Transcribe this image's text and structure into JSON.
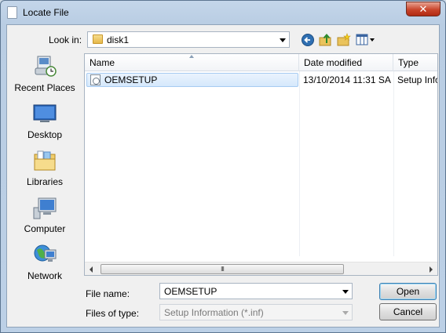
{
  "window": {
    "title": "Locate File",
    "close_glyph": "✕"
  },
  "toolbar": {
    "look_in_label": "Look in:",
    "look_in_value": "disk1",
    "icons": [
      "back-icon",
      "up-folder-icon",
      "new-folder-icon",
      "view-menu-icon"
    ]
  },
  "places": [
    {
      "label": "Recent Places",
      "icon": "recent-places-icon"
    },
    {
      "label": "Desktop",
      "icon": "desktop-icon"
    },
    {
      "label": "Libraries",
      "icon": "libraries-icon"
    },
    {
      "label": "Computer",
      "icon": "computer-icon"
    },
    {
      "label": "Network",
      "icon": "network-icon"
    }
  ],
  "list": {
    "columns": [
      "Name",
      "Date modified",
      "Type"
    ],
    "rows": [
      {
        "name": "OEMSETUP",
        "date": "13/10/2014 11:31 SA",
        "type": "Setup Info"
      }
    ],
    "scroll_thumb_glyph": "III"
  },
  "form": {
    "file_name_label": "File name:",
    "file_name_value": "OEMSETUP",
    "files_of_type_label": "Files of type:",
    "files_of_type_value": "Setup Information (*.inf)",
    "open_label": "Open",
    "cancel_label": "Cancel"
  },
  "colors": {
    "selection": "#d5e8fc",
    "close_button": "#c9452b",
    "accent": "#3c7fb1"
  }
}
